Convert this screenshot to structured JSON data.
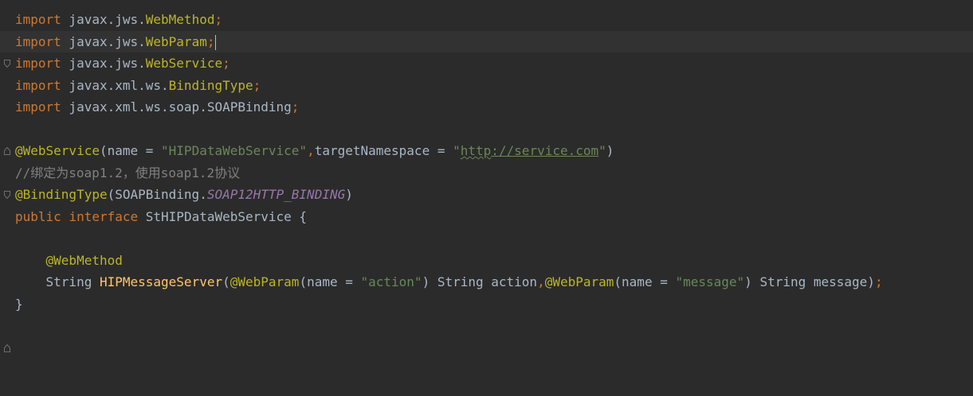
{
  "icons": {
    "fold": "fold-marker-icon"
  },
  "colors": {
    "background": "#2b2b2b",
    "current_line": "#323232",
    "keyword": "#cc7832",
    "annotation": "#bbb529",
    "string": "#6a8759",
    "comment": "#808080",
    "constant": "#9876aa",
    "method": "#ffc66d",
    "plain": "#a9b7c6"
  },
  "code": {
    "l1": {
      "kw": "import",
      "pkg": " javax.jws.",
      "cls": "WebMethod",
      "semi": ";"
    },
    "l2": {
      "kw": "import",
      "pkg": " javax.jws.",
      "cls": "WebParam",
      "semi": ";"
    },
    "l3": {
      "kw": "import",
      "pkg": " javax.jws.",
      "cls": "WebService",
      "semi": ";"
    },
    "l4": {
      "kw": "import",
      "pkg": " javax.xml.ws.",
      "cls": "BindingType",
      "semi": ";"
    },
    "l5": {
      "kw": "import",
      "pkg": " javax.xml.ws.soap.",
      "cls": "SOAPBinding",
      "semi": ";"
    },
    "l7": {
      "ann": "@WebService",
      "p1": "(name = ",
      "s1": "\"HIPDataWebService\"",
      "comma": ",",
      "p2": "targetNamespace = ",
      "q1": "\"",
      "url_a": "http",
      "url_b": "://",
      "url_c": "service.com",
      "q2": "\"",
      "p3": ")"
    },
    "l8": {
      "cmt_a": "//",
      "cmt_b": "绑定为",
      "cmt_c": "soap1.2",
      "cmt_d": "，使用",
      "cmt_e": "soap1.2",
      "cmt_f": "协议"
    },
    "l9": {
      "ann": "@BindingType",
      "p1": "(SOAPBinding.",
      "const": "SOAP12HTTP_BINDING",
      "p2": ")"
    },
    "l10": {
      "kw1": "public",
      "sp": " ",
      "kw2": "interface",
      "rest": " StHIPDataWebService {"
    },
    "l12": {
      "indent": "    ",
      "ann": "@WebMethod"
    },
    "l13": {
      "indent": "    ",
      "type": "String ",
      "method": "HIPMessageServer",
      "p1": "(",
      "ann1": "@WebParam",
      "p2": "(name = ",
      "s1": "\"action\"",
      "p3": ") String action",
      "comma": ",",
      "ann2": "@WebParam",
      "p4": "(name = ",
      "s2": "\"message\"",
      "p5": ") String message)",
      "semi": ";"
    },
    "l14": {
      "brace": "}"
    }
  }
}
